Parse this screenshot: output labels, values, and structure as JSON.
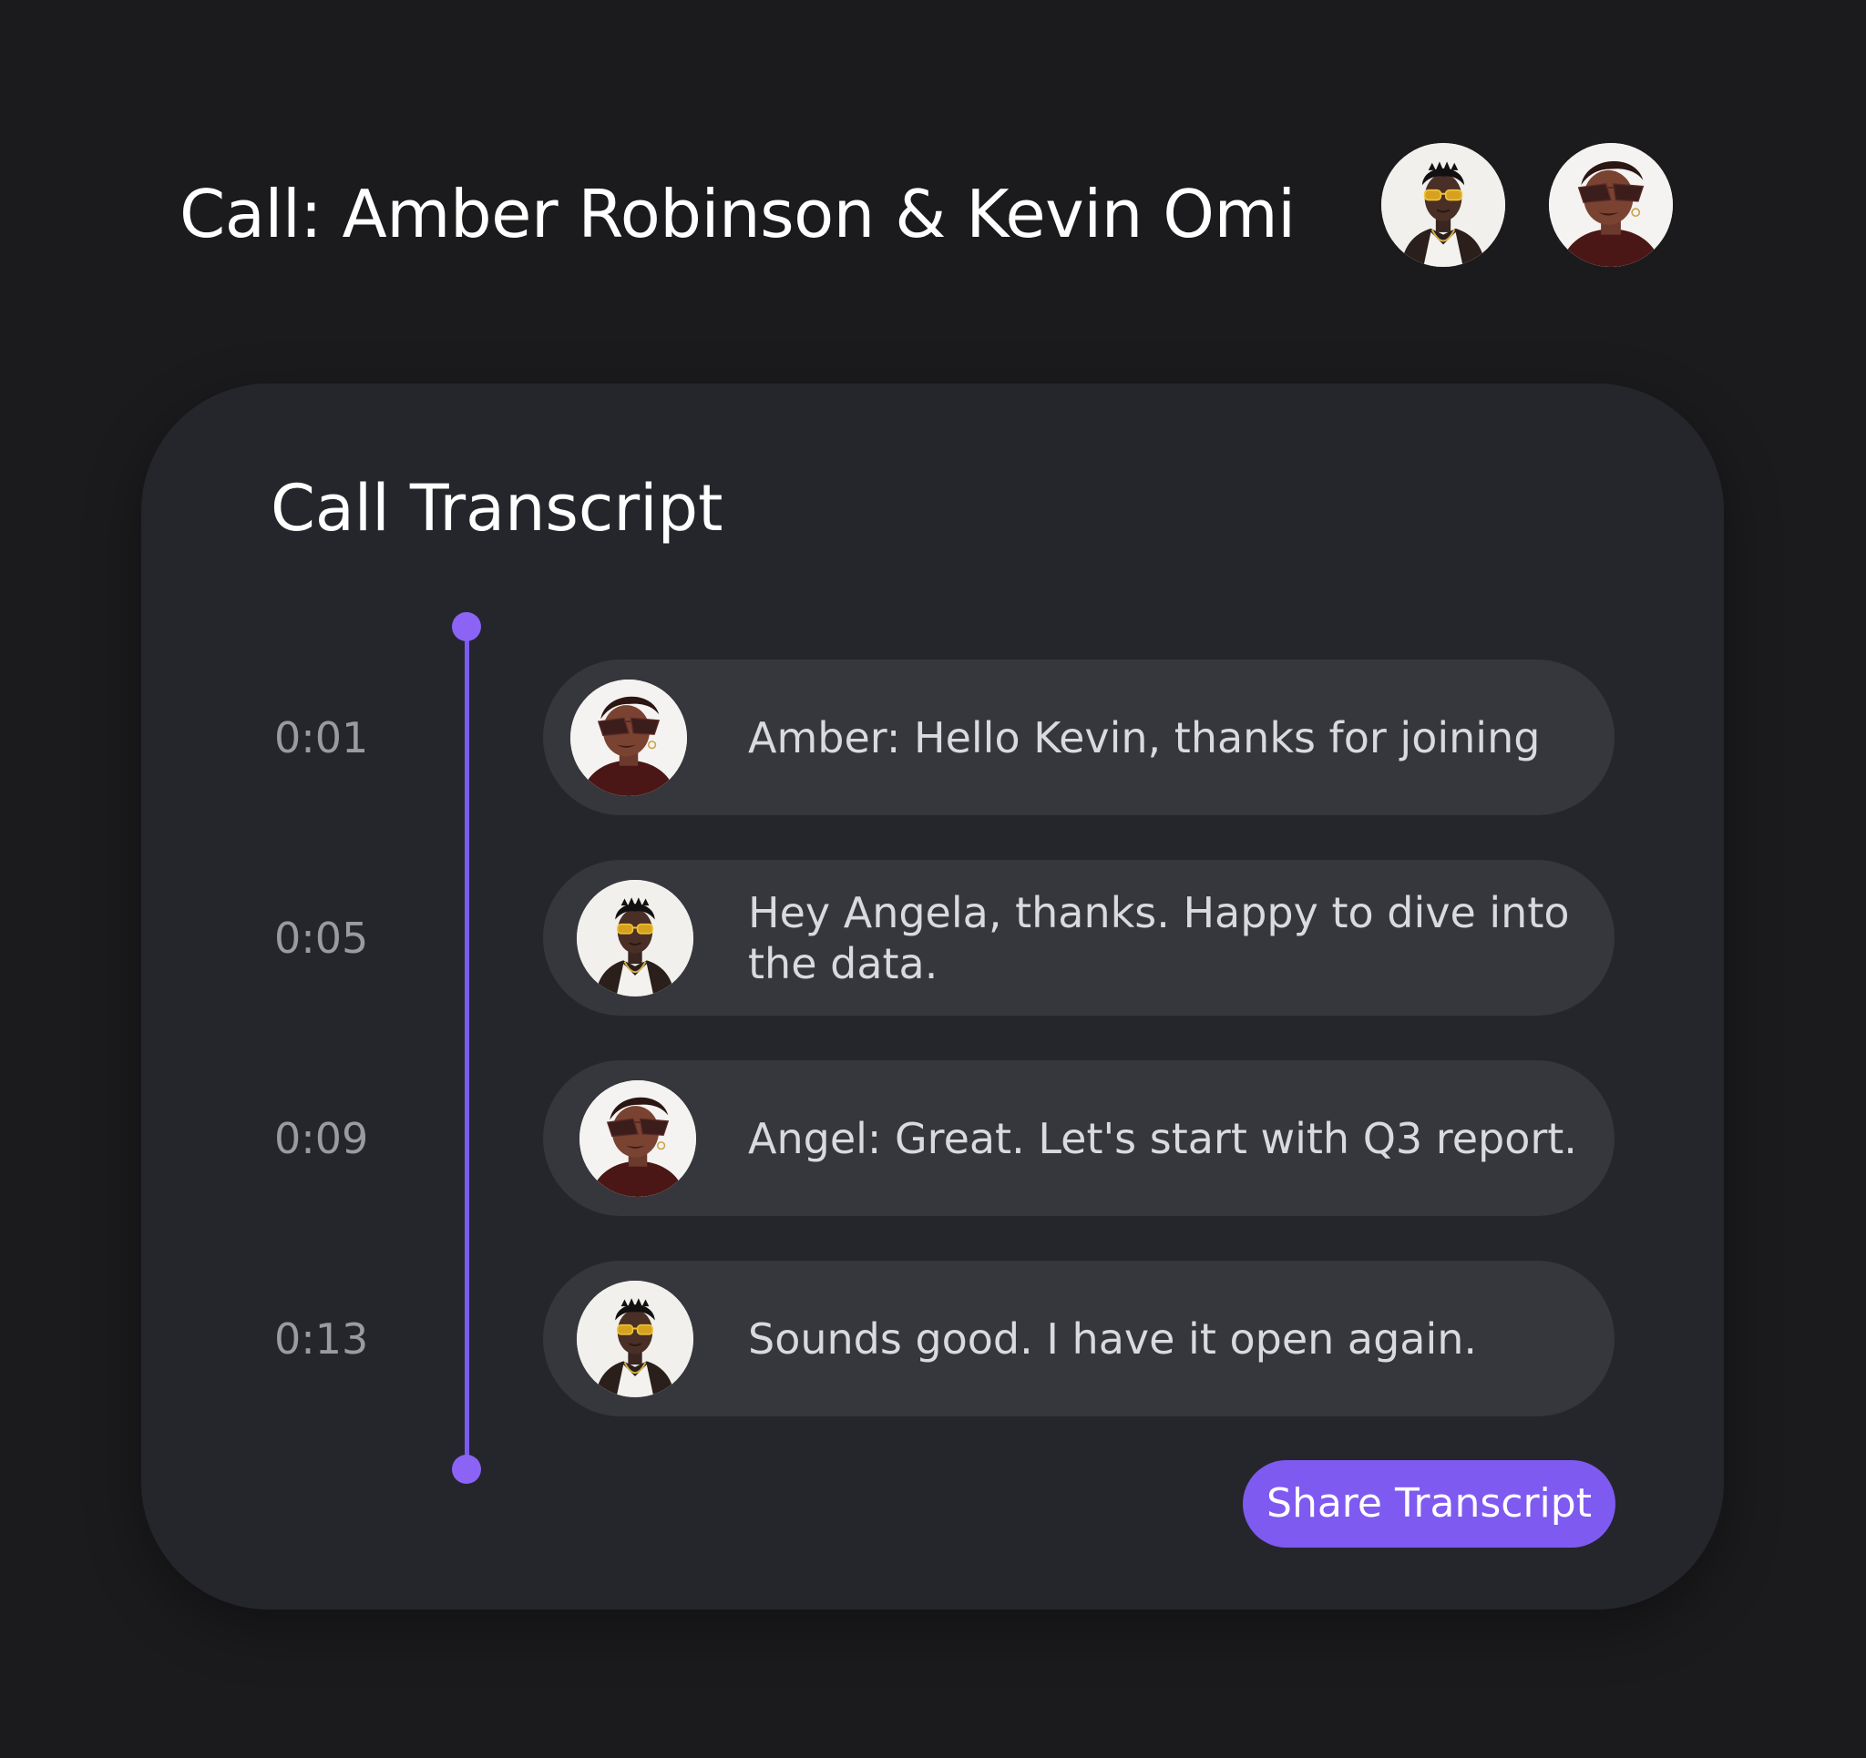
{
  "header": {
    "title": "Call: Amber Robinson & Kevin Omi",
    "participants": [
      {
        "name": "Kevin Omi",
        "avatar": "man-sunglasses-avatar"
      },
      {
        "name": "Amber Robinson",
        "avatar": "woman-sunglasses-avatar"
      }
    ]
  },
  "transcript": {
    "title": "Call Transcript",
    "messages": [
      {
        "time": "0:01",
        "text": "Amber: Hello Kevin, thanks for joining",
        "avatar": "woman-sunglasses-avatar"
      },
      {
        "time": "0:05",
        "text": "Hey Angela, thanks. Happy to dive into the data.",
        "avatar": "man-sunglasses-avatar"
      },
      {
        "time": "0:09",
        "text": "Angel: Great. Let's start with Q3 report.",
        "avatar": "woman-sunglasses-avatar"
      },
      {
        "time": "0:13",
        "text": "Sounds good. I have it open again.",
        "avatar": "man-sunglasses-avatar"
      }
    ],
    "share_label": "Share Transcript"
  },
  "colors": {
    "background": "#1b1b1d",
    "card": "#25262b",
    "message_bubble": "#35373c",
    "accent": "#7f5af0",
    "timestamp": "#9a9ba1"
  }
}
